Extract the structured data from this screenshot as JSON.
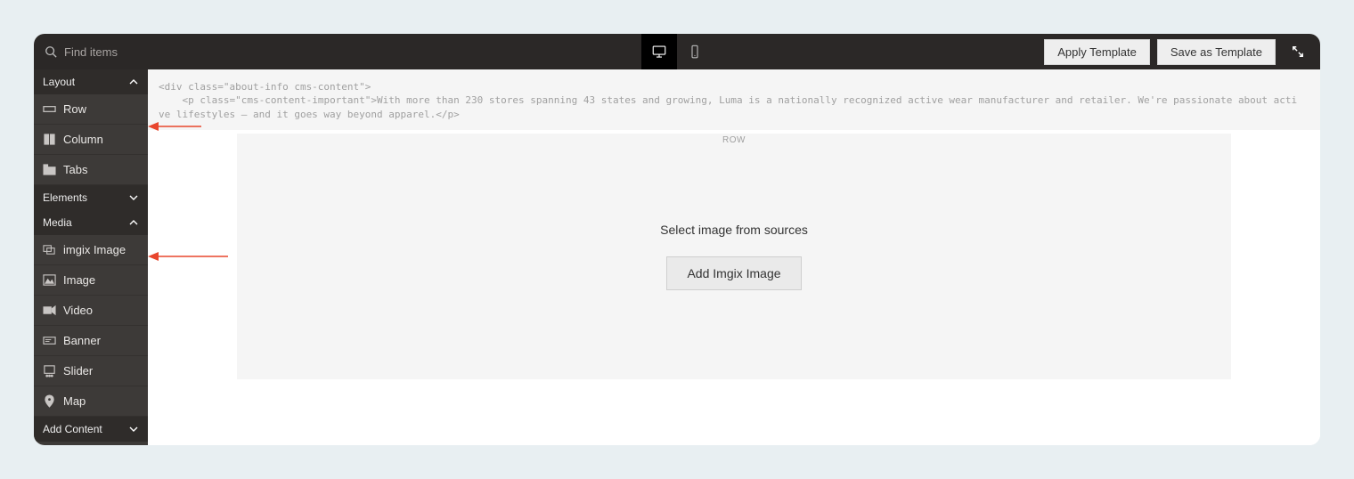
{
  "search": {
    "placeholder": "Find items"
  },
  "actions": {
    "apply_template": "Apply Template",
    "save_template": "Save as Template"
  },
  "sidebar": {
    "layout": {
      "label": "Layout",
      "items": [
        {
          "label": "Row"
        },
        {
          "label": "Column"
        },
        {
          "label": "Tabs"
        }
      ]
    },
    "elements": {
      "label": "Elements"
    },
    "media": {
      "label": "Media",
      "items": [
        {
          "label": "imgix Image"
        },
        {
          "label": "Image"
        },
        {
          "label": "Video"
        },
        {
          "label": "Banner"
        },
        {
          "label": "Slider"
        },
        {
          "label": "Map"
        }
      ]
    },
    "add_content": {
      "label": "Add Content"
    }
  },
  "code": {
    "line1": "<div class=\"about-info cms-content\">",
    "line2": "    <p class=\"cms-content-important\">With more than 230 stores spanning 43 states and growing, Luma is a nationally recognized active wear manufacturer and retailer. We're passionate about active lifestyles – and it goes way beyond apparel.</p>"
  },
  "canvas": {
    "row_label": "ROW",
    "select_text": "Select image from sources",
    "add_button": "Add Imgix Image"
  }
}
